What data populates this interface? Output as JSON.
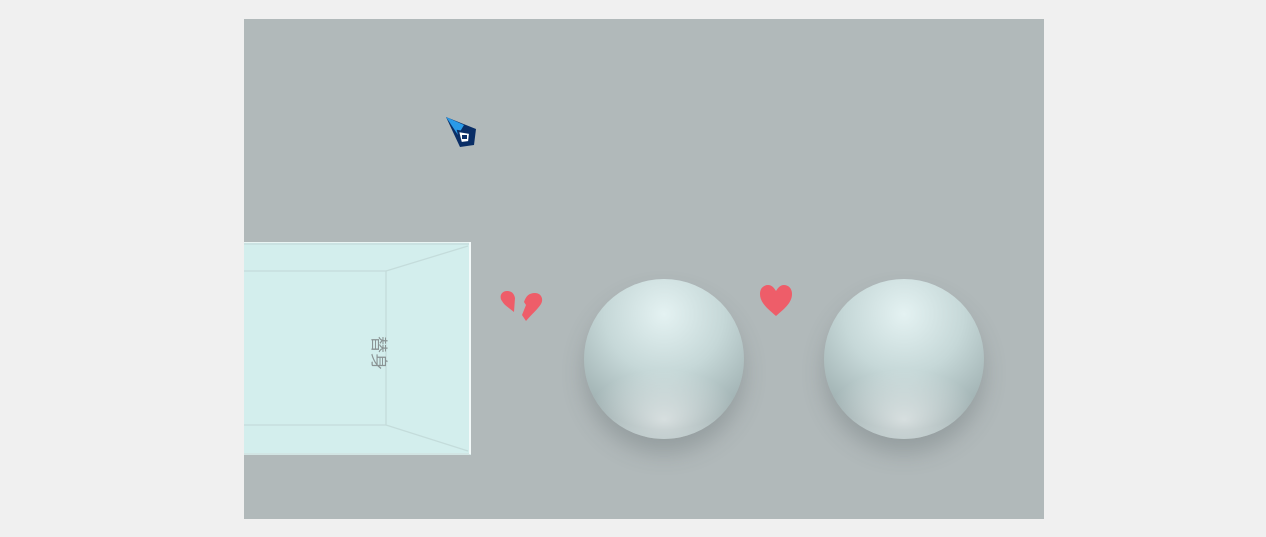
{
  "scene": {
    "box_label": "替身",
    "background_color": "#b1b9ba",
    "box_color": "#d3eeed",
    "heart_color": "#ee5d69",
    "cursor_color": "#1f83d6"
  },
  "icons": {
    "cursor": "pen-cursor-icon",
    "broken_heart": "broken-heart-icon",
    "heart": "heart-icon"
  }
}
